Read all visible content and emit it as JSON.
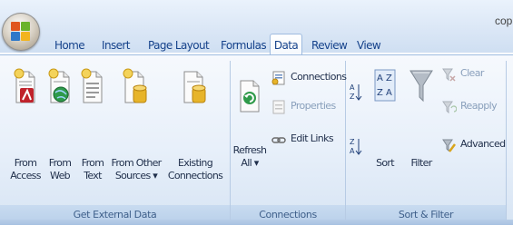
{
  "window": {
    "title_fragment": "cop"
  },
  "tabs": [
    {
      "label": "Home"
    },
    {
      "label": "Insert"
    },
    {
      "label": "Page Layout"
    },
    {
      "label": "Formulas"
    },
    {
      "label": "Data",
      "active": true
    },
    {
      "label": "Review"
    },
    {
      "label": "View"
    }
  ],
  "groups": {
    "get_external_data": {
      "label": "Get External Data",
      "buttons": [
        {
          "line1": "From",
          "line2": "Access"
        },
        {
          "line1": "From",
          "line2": "Web"
        },
        {
          "line1": "From",
          "line2": "Text"
        },
        {
          "line1": "From Other",
          "line2": "Sources ▾"
        },
        {
          "line1": "Existing",
          "line2": "Connections"
        }
      ]
    },
    "connections": {
      "label": "Connections",
      "refresh": {
        "line1": "Refresh",
        "line2": "All ▾"
      },
      "connections_label": "Connections",
      "properties_label": "Properties",
      "edit_links_label": "Edit Links"
    },
    "sort_filter": {
      "label": "Sort & Filter",
      "sort_label": "Sort",
      "filter_label": "Filter",
      "clear_label": "Clear",
      "reapply_label": "Reapply",
      "advanced_label": "Advanced"
    }
  },
  "colors": {
    "accent": "#15428b",
    "ribbon": "#dbe7f6",
    "filter_funnel": "#9aa3ad"
  }
}
